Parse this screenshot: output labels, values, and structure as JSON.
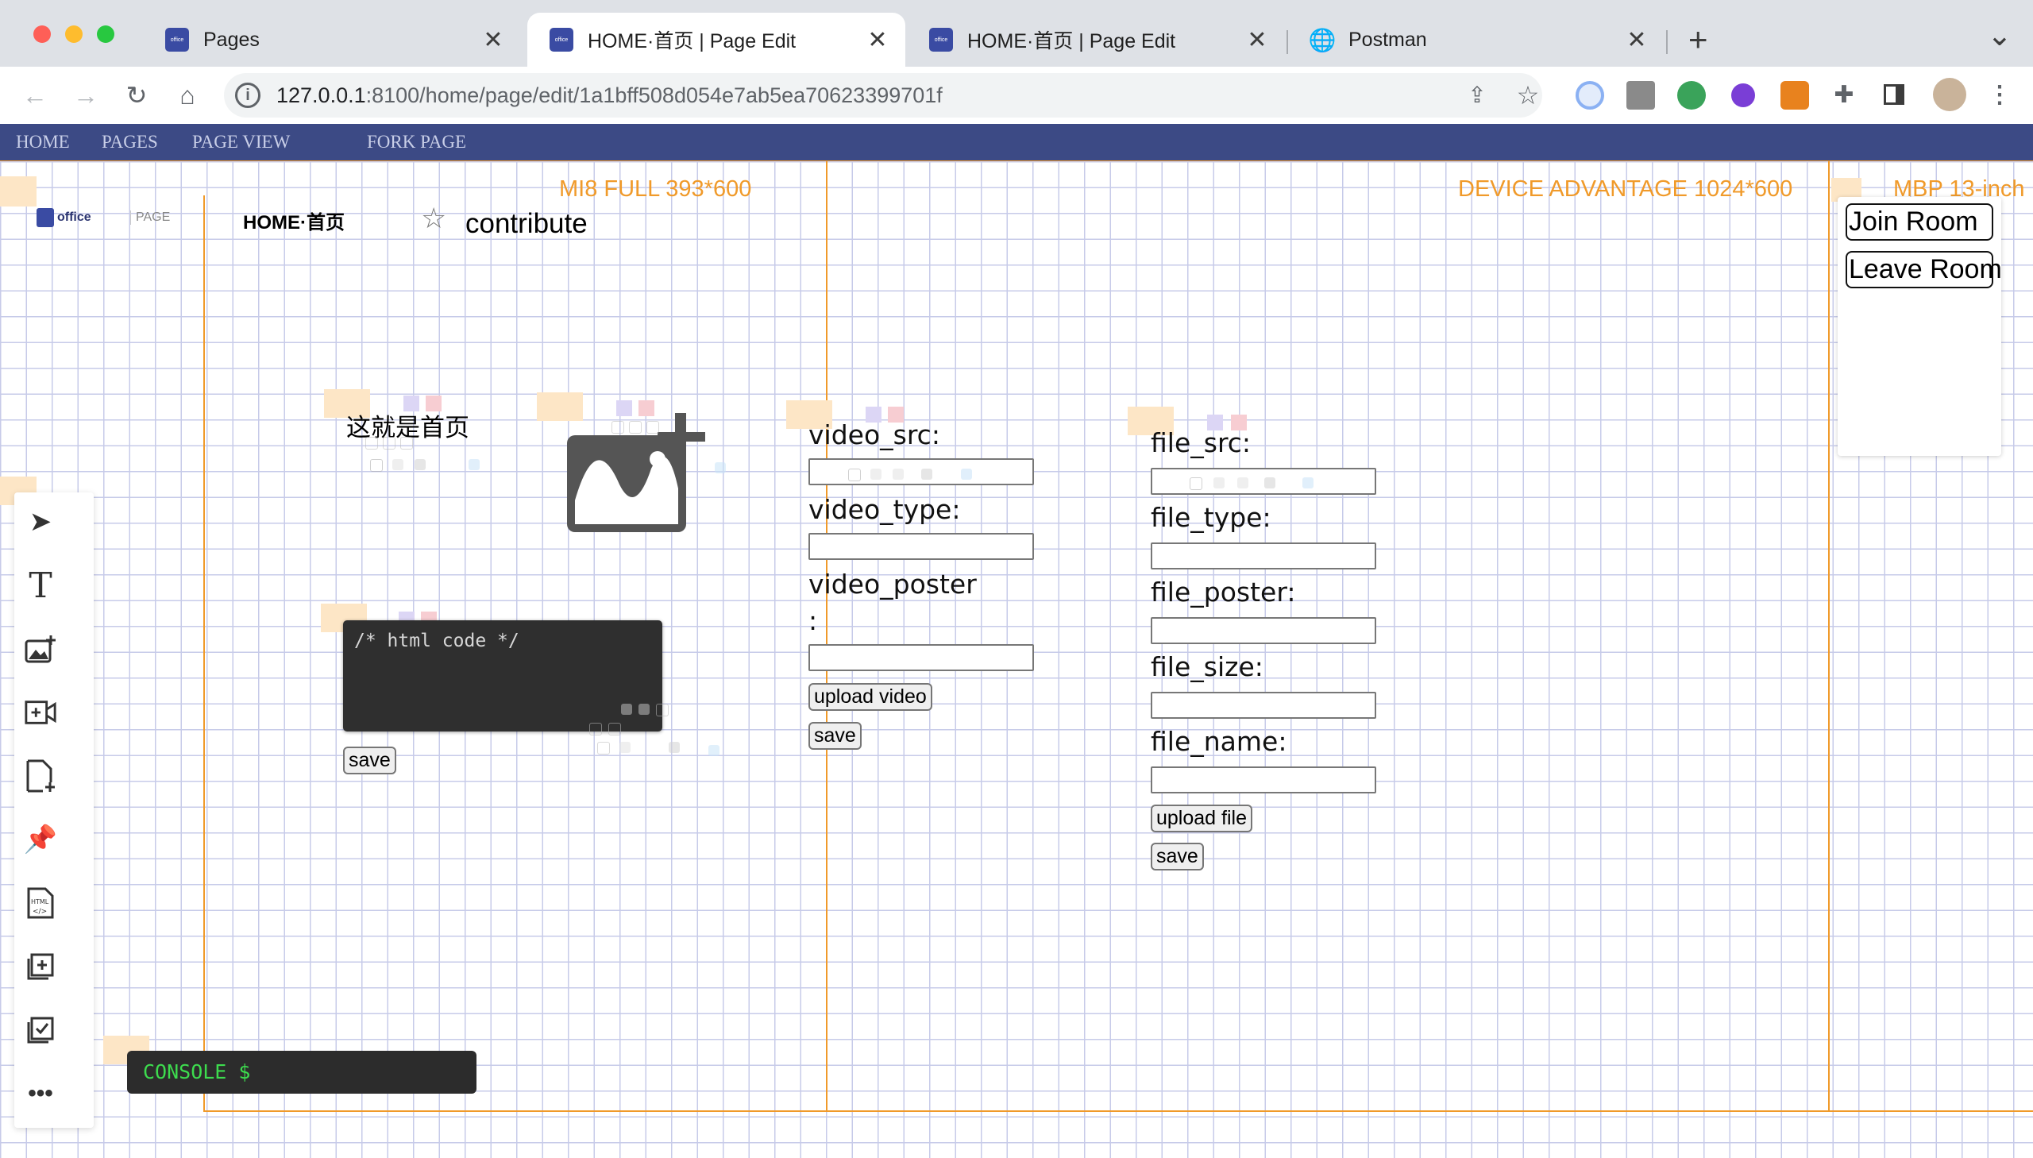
{
  "browser": {
    "tabs": [
      {
        "title": "Pages",
        "favicon": "office-logo"
      },
      {
        "title": "HOME·首页 | Page Edit",
        "favicon": "office-logo",
        "active": true
      },
      {
        "title": "HOME·首页 | Page Edit",
        "favicon": "office-logo"
      },
      {
        "title": "Postman",
        "favicon": "globe-icon"
      }
    ],
    "favicon_text": "office",
    "close_glyph": "✕",
    "new_tab_glyph": "+",
    "tab_menu_glyph": "⌄",
    "address": {
      "host": "127.0.0.1",
      "path": ":8100/home/page/edit/1a1bff508d054e7ab5ea70623399701f"
    },
    "info_glyph": "i"
  },
  "app_nav": {
    "items": [
      "HOME",
      "PAGES",
      "PAGE VIEW",
      "FORK PAGE"
    ]
  },
  "header": {
    "logo_text": "office",
    "page_badge": "PAGE",
    "page_title": "HOME·首页",
    "contribute": "contribute"
  },
  "devices": {
    "mi8": "MI8 FULL 393*600",
    "advantage": "DEVICE ADVANTAGE 1024*600",
    "mbp": "MBP 13-inch"
  },
  "content": {
    "heading_text": "这就是首页",
    "code_placeholder": "/* html code */",
    "code_save": "save",
    "video": {
      "src_label": "video_src:",
      "type_label": "video_type:",
      "poster_label": "video_poster",
      "poster_colon": ":",
      "upload": "upload video",
      "save": "save"
    },
    "file": {
      "src_label": "file_src:",
      "type_label": "file_type:",
      "poster_label": "file_poster:",
      "size_label": "file_size:",
      "name_label": "file_name:",
      "upload": "upload file",
      "save": "save"
    }
  },
  "room": {
    "join": "Join Room",
    "leave": "Leave Room"
  },
  "console": {
    "label": "CONSOLE $"
  },
  "colors": {
    "accent_orange": "#f09a2a",
    "nav_bg": "#3c4a85",
    "console_green": "#3ddc4e"
  }
}
